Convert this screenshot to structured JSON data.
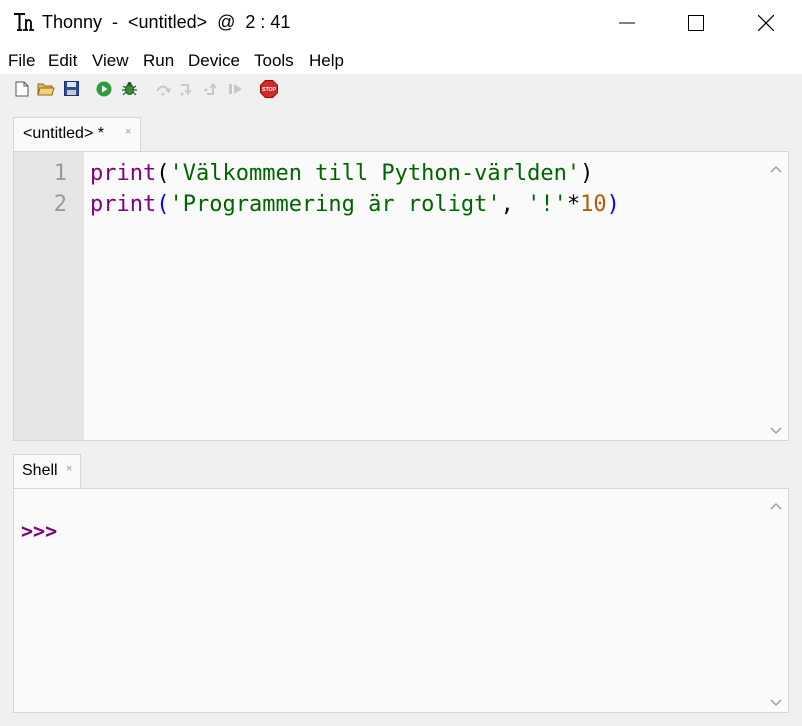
{
  "window": {
    "title": "Thonny  -  <untitled>  @  2 : 41",
    "controls": [
      "minimize-icon",
      "maximize-icon",
      "close-icon"
    ]
  },
  "menu": {
    "items": [
      "File",
      "Edit",
      "View",
      "Run",
      "Device",
      "Tools",
      "Help"
    ]
  },
  "toolbar": {
    "icons": [
      "new-file-icon",
      "open-folder-icon",
      "save-icon",
      "run-icon",
      "debug-icon",
      "step-over-icon",
      "step-into-icon",
      "step-out-icon",
      "resume-icon",
      "stop-icon"
    ],
    "stop_label": "STOP"
  },
  "editor": {
    "tab_label": "<untitled> *",
    "tab_close": "×",
    "lines": [
      {
        "number": "1",
        "tokens": {
          "fn": "print",
          "open": "(",
          "str": "'Välkommen till Python-världen'",
          "close": ")"
        }
      },
      {
        "number": "2",
        "tokens": {
          "fn": "print",
          "open": "(",
          "str1": "'Programmering är roligt'",
          "comma": ", ",
          "str2": "'!'",
          "op": "*",
          "num": "10",
          "close": ")"
        }
      }
    ]
  },
  "shell": {
    "tab_label": "Shell",
    "tab_close": "×",
    "prompt": ">>>"
  },
  "colors": {
    "keyword": "#800080",
    "string": "#006400",
    "number": "#b35c00",
    "bracket_matched": "#0000ff",
    "prompt": "#800080",
    "gutter_bg": "#e6e6e6",
    "editor_bg": "#fafafa"
  }
}
